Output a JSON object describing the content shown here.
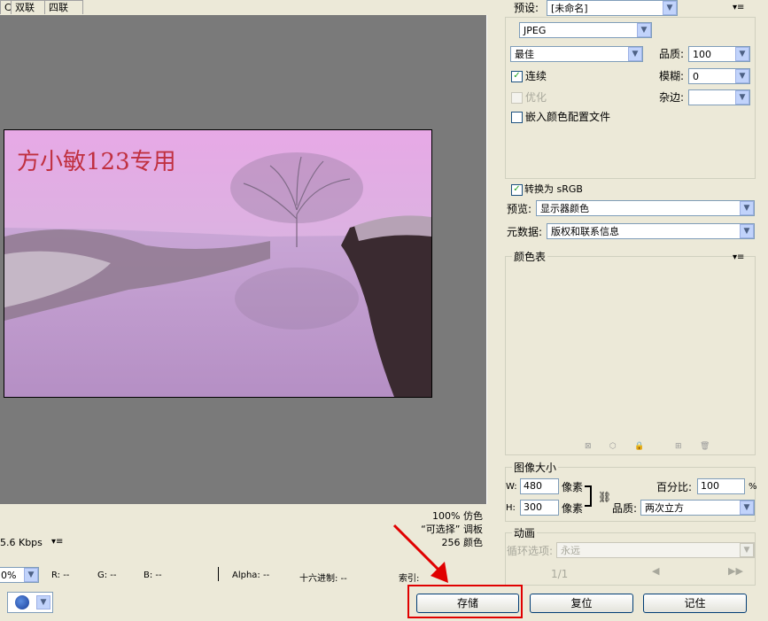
{
  "tabs": [
    "C",
    "双联",
    "四联"
  ],
  "preview": {
    "watermark": "方小敏123专用",
    "info_lines": [
      "100% 仿色",
      "“可选择” 调板",
      "256 颜色"
    ],
    "speed": "5.6 Kbps"
  },
  "statusbar": {
    "zoom": "0%",
    "r": "R: --",
    "g": "G: --",
    "b": "B: --",
    "alpha": "Alpha: --",
    "hex": "十六进制: --",
    "index": "索引:"
  },
  "settings": {
    "preset_label": "预设:",
    "preset_value": "[未命名]",
    "format": "JPEG",
    "quality_preset": "最佳",
    "quality_label": "品质:",
    "quality_value": "100",
    "progressive_label": "连续",
    "blur_label": "模糊:",
    "blur_value": "0",
    "optimized_label": "优化",
    "matte_label": "杂边:",
    "embed_profile_label": "嵌入颜色配置文件",
    "convert_srgb_label": "转换为 sRGB",
    "preview_label": "预览:",
    "preview_value": "显示器颜色",
    "metadata_label": "元数据:",
    "metadata_value": "版权和联系信息"
  },
  "color_table": {
    "title": "颜色表"
  },
  "image_size": {
    "title": "图像大小",
    "w_label": "W:",
    "w_value": "480",
    "h_label": "H:",
    "h_value": "300",
    "unit": "像素",
    "percent_label": "百分比:",
    "percent_value": "100",
    "percent_unit": "%",
    "quality_label": "品质:",
    "quality_value": "两次立方"
  },
  "animation": {
    "title": "动画",
    "loop_label": "循环选项:",
    "loop_value": "永远",
    "frame": "1/1"
  },
  "buttons": {
    "save": "存储",
    "reset": "复位",
    "remember": "记住"
  },
  "colors": {
    "highlight_box": "#e00000",
    "arrow": "#e00000"
  }
}
